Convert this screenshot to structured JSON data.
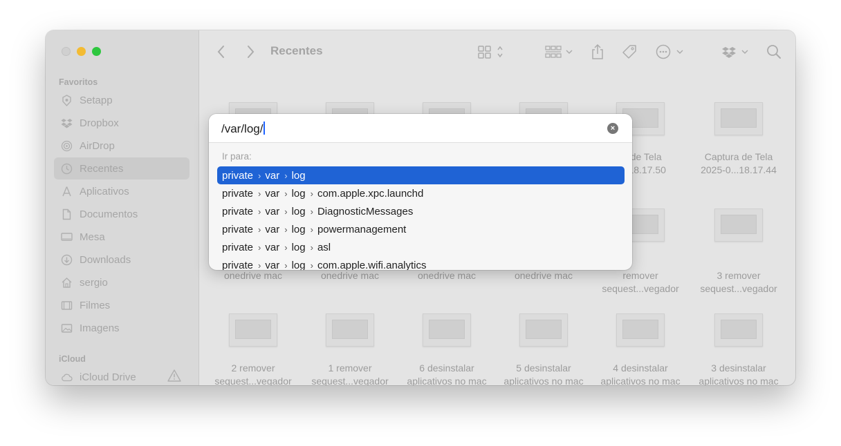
{
  "toolbar": {
    "title": "Recentes"
  },
  "sidebar": {
    "favorites_title": "Favoritos",
    "favorites": [
      {
        "label": "Setapp",
        "icon": "setapp-icon"
      },
      {
        "label": "Dropbox",
        "icon": "dropbox-icon"
      },
      {
        "label": "AirDrop",
        "icon": "airdrop-icon"
      },
      {
        "label": "Recentes",
        "icon": "clock-icon"
      },
      {
        "label": "Aplicativos",
        "icon": "applications-icon"
      },
      {
        "label": "Documentos",
        "icon": "document-icon"
      },
      {
        "label": "Mesa",
        "icon": "desktop-icon"
      },
      {
        "label": "Downloads",
        "icon": "download-icon"
      },
      {
        "label": "sergio",
        "icon": "home-icon"
      },
      {
        "label": "Filmes",
        "icon": "film-icon"
      },
      {
        "label": "Imagens",
        "icon": "image-icon"
      }
    ],
    "icloud_title": "iCloud",
    "icloud": [
      {
        "label": "iCloud Drive",
        "icon": "icloud-icon"
      }
    ]
  },
  "files": {
    "row1": [
      {
        "line1": "",
        "line2": ""
      },
      {
        "line1": "",
        "line2": ""
      },
      {
        "line1": "",
        "line2": ""
      },
      {
        "line1": "",
        "line2": ""
      },
      {
        "line1": "ra de Tela",
        "line2": "0...18.17.50"
      },
      {
        "line1": "Captura de Tela",
        "line2": "2025-0...18.17.44"
      }
    ],
    "row2": [
      {
        "line1": "onedrive mac",
        "line2": ""
      },
      {
        "line1": "onedrive mac",
        "line2": ""
      },
      {
        "line1": "onedrive mac",
        "line2": ""
      },
      {
        "line1": "onedrive mac",
        "line2": ""
      },
      {
        "line1": "remover",
        "line2": "sequest...vegador"
      },
      {
        "line1": "3 remover",
        "line2": "sequest...vegador"
      }
    ],
    "row3": [
      {
        "line1": "2 remover",
        "line2": "sequest...vegador"
      },
      {
        "line1": "1 remover",
        "line2": "sequest...vegador"
      },
      {
        "line1": "6 desinstalar",
        "line2": "aplicativos no mac"
      },
      {
        "line1": "5 desinstalar",
        "line2": "aplicativos no mac"
      },
      {
        "line1": "4 desinstalar",
        "line2": "aplicativos no mac"
      },
      {
        "line1": "3 desinstalar",
        "line2": "aplicativos no mac"
      }
    ]
  },
  "dialog": {
    "input_value": "/var/log/",
    "goto_label": "Ir para:",
    "suggestions": [
      [
        "private",
        "var",
        "log"
      ],
      [
        "private",
        "var",
        "log",
        "com.apple.xpc.launchd"
      ],
      [
        "private",
        "var",
        "log",
        "DiagnosticMessages"
      ],
      [
        "private",
        "var",
        "log",
        "powermanagement"
      ],
      [
        "private",
        "var",
        "log",
        "asl"
      ],
      [
        "private",
        "var",
        "log",
        "com.apple.wifi.analytics"
      ]
    ],
    "selected_index": 0,
    "separator": "›",
    "clear_symbol": "×"
  },
  "colors": {
    "accent": "#1f63d5",
    "traffic_yellow": "#f3bb33",
    "traffic_green": "#2ec73f"
  }
}
